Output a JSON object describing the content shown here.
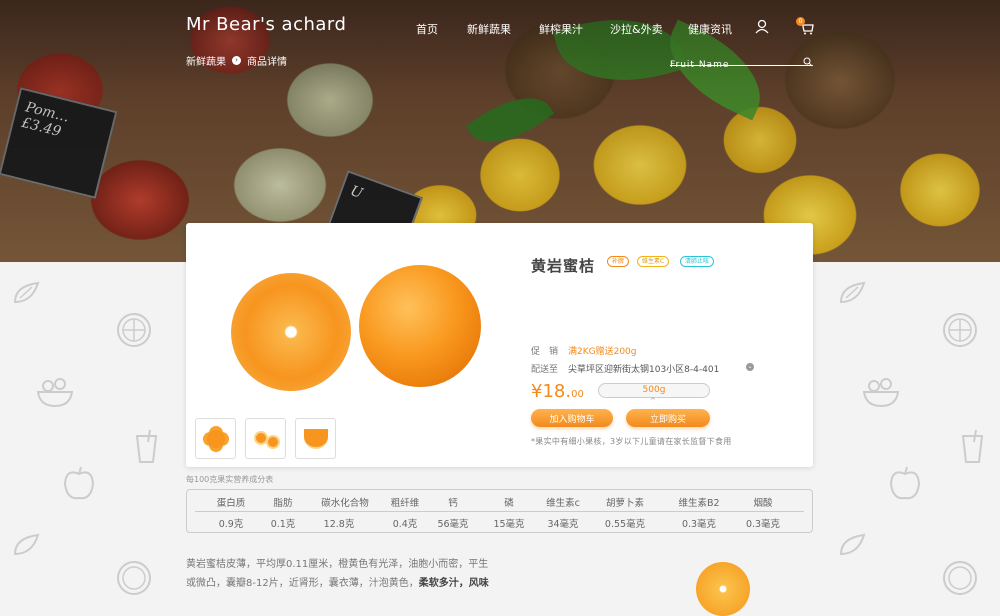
{
  "header": {
    "logo": "Mr Bear's achard",
    "nav": [
      "首页",
      "新鲜蔬果",
      "鲜榨果汁",
      "沙拉&外卖",
      "健康资讯"
    ],
    "cart_count": "0",
    "breadcrumb": [
      "新鲜蔬果",
      "商品详情"
    ],
    "search_placeholder": "Fruit Name"
  },
  "product": {
    "title": "黄岩蜜桔",
    "tags": [
      {
        "label": "补脾",
        "color": "#f28a1c"
      },
      {
        "label": "维生素C",
        "color": "#f2b21c"
      },
      {
        "label": "清肺止咳",
        "color": "#2bc4d8"
      }
    ],
    "promo_label": "促　销",
    "promo_value": "满2KG赠送200g",
    "ship_label": "配送至",
    "ship_value": "尖草坪区迎新街太钢103小区8-4-401",
    "price_symbol": "¥",
    "price_int": "18.",
    "price_dec": "00",
    "weight": "500g",
    "add_cart": "加入购物车",
    "buy_now": "立即购买",
    "note": "*果实中有细小果核，3岁以下儿童请在家长监督下食用",
    "thumbnails": [
      "thumb-1",
      "thumb-2",
      "thumb-3"
    ]
  },
  "nutrition": {
    "title": "每100克果实营养成分表",
    "headers": [
      "蛋白质",
      "脂肪",
      "碳水化合物",
      "粗纤维",
      "钙",
      "磷",
      "维生素c",
      "胡萝卜素",
      "维生素B2",
      "烟酸"
    ],
    "values": [
      "0.9克",
      "0.1克",
      "12.8克",
      "0.4克",
      "56毫克",
      "15毫克",
      "34毫克",
      "0.55毫克",
      "0.3毫克",
      "0.3毫克"
    ]
  },
  "description": {
    "line1": "黄岩蜜桔皮薄，平均厚0.11厘米，橙黄色有光泽，油胞小而密，平生",
    "line2_plain": "或微凸，囊瓣8-12片，近肾形，囊衣薄，汁泡黄色，",
    "line2_bold": "柔软多汁，风味"
  },
  "colors": {
    "accent": "#f28a1c",
    "accent_light": "#ffb24d"
  }
}
